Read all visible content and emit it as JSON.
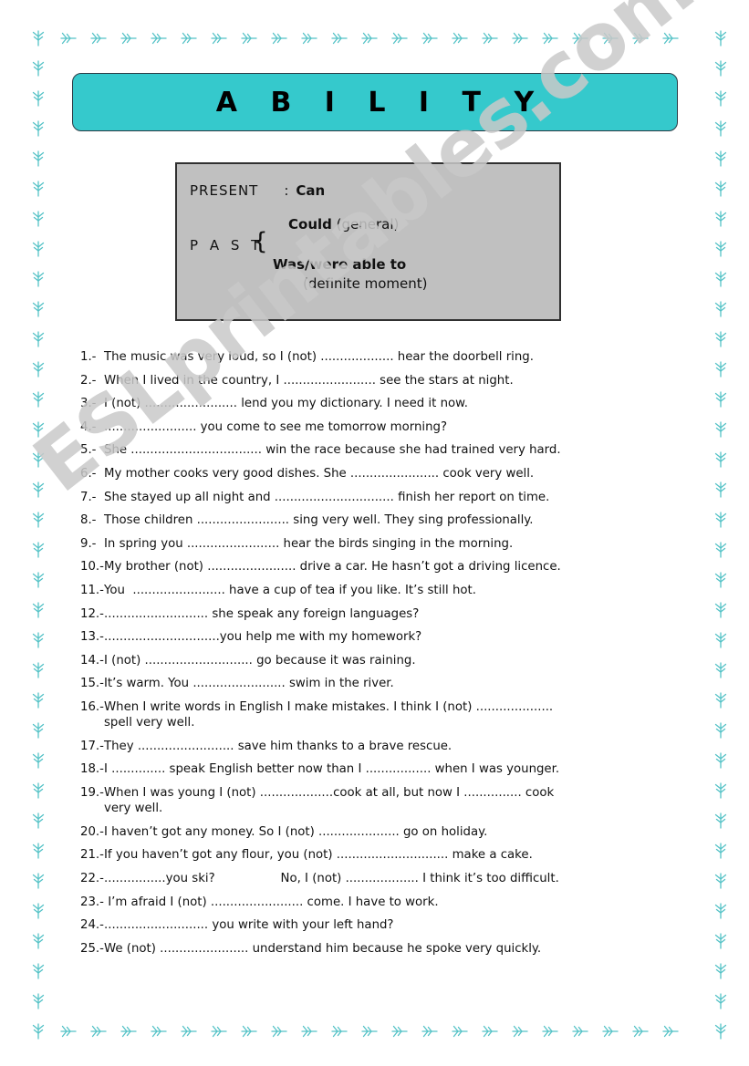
{
  "title": {
    "text": "A B I L I T Y",
    "banner_color": "#35c9cc"
  },
  "grammar_box": {
    "present_label": "PRESENT",
    "present_colon": ":",
    "present_value": "Can",
    "past_label": "P A S T",
    "brace": "{",
    "past_option_1_bold": "Could",
    "past_option_1_note": " (general)",
    "past_option_2_bold": "Was/were able to",
    "past_option_2_note": "(definite moment)",
    "box_color": "#c0c0c0"
  },
  "watermark": {
    "text": "ESLprintables.com",
    "color": "#c9c9c9"
  },
  "exercises": [
    {
      "num": "1.-",
      "text": "The music was very loud, so I (not) ................... hear the doorbell ring."
    },
    {
      "num": "2.-",
      "text": "When I lived in the country, I ........................ see the stars at night."
    },
    {
      "num": "3.-",
      "text": "I (not) ........................ lend you my dictionary. I need it now."
    },
    {
      "num": "4.-",
      "text": "........................ you come to see me tomorrow morning?"
    },
    {
      "num": "5.-",
      "text": "She .................................. win the race because she had trained very hard."
    },
    {
      "num": "6.-",
      "text": "My mother cooks very good dishes. She ....................... cook very well."
    },
    {
      "num": "7.-",
      "text": "She stayed up all night and ............................... finish her report on time."
    },
    {
      "num": "8.-",
      "text": "Those children ........................ sing very well. They sing professionally."
    },
    {
      "num": "9.-",
      "text": "In spring you ........................ hear the birds singing in the morning."
    },
    {
      "num": "10.-",
      "text": "My brother (not) ....................... drive a car. He hasn’t got a driving licence."
    },
    {
      "num": "11.-",
      "text": "You  ........................ have a cup of tea if you like. It’s still hot."
    },
    {
      "num": "12.-",
      "text": "........................... she speak any foreign languages?"
    },
    {
      "num": "13.-",
      "text": "..............................you help me with my homework?"
    },
    {
      "num": "14.-",
      "text": "I (not) ............................ go because it was raining."
    },
    {
      "num": "15.-",
      "text": "It’s warm. You ........................ swim in the river."
    },
    {
      "num": "16.-",
      "text": "When I write words in English I make mistakes. I think I (not) ....................",
      "continuation": "spell very well."
    },
    {
      "num": "17.-",
      "text": "They ......................... save him thanks to a brave rescue."
    },
    {
      "num": "18.-",
      "text": "I .............. speak English better now than I ................. when I was younger."
    },
    {
      "num": "19.-",
      "text": "When I was young I (not) ...................cook at all, but now I ............... cook",
      "continuation": "very well."
    },
    {
      "num": "20.-",
      "text": "I haven’t got any money. So I (not) ..................... go on holiday."
    },
    {
      "num": "21.-",
      "text": "If you haven’t got any flour, you (not) ............................. make a cake."
    },
    {
      "num": "22.-",
      "text": "................you ski?                 No, I (not) ................... I think it’s too difficult."
    },
    {
      "num": "23.-",
      "text": " I’m afraid I (not) ........................ come. I have to work."
    },
    {
      "num": "24.-",
      "text": "........................... you write with your left hand?"
    },
    {
      "num": "25.-",
      "text": "We (not) ....................... understand him because he spoke very quickly."
    }
  ]
}
